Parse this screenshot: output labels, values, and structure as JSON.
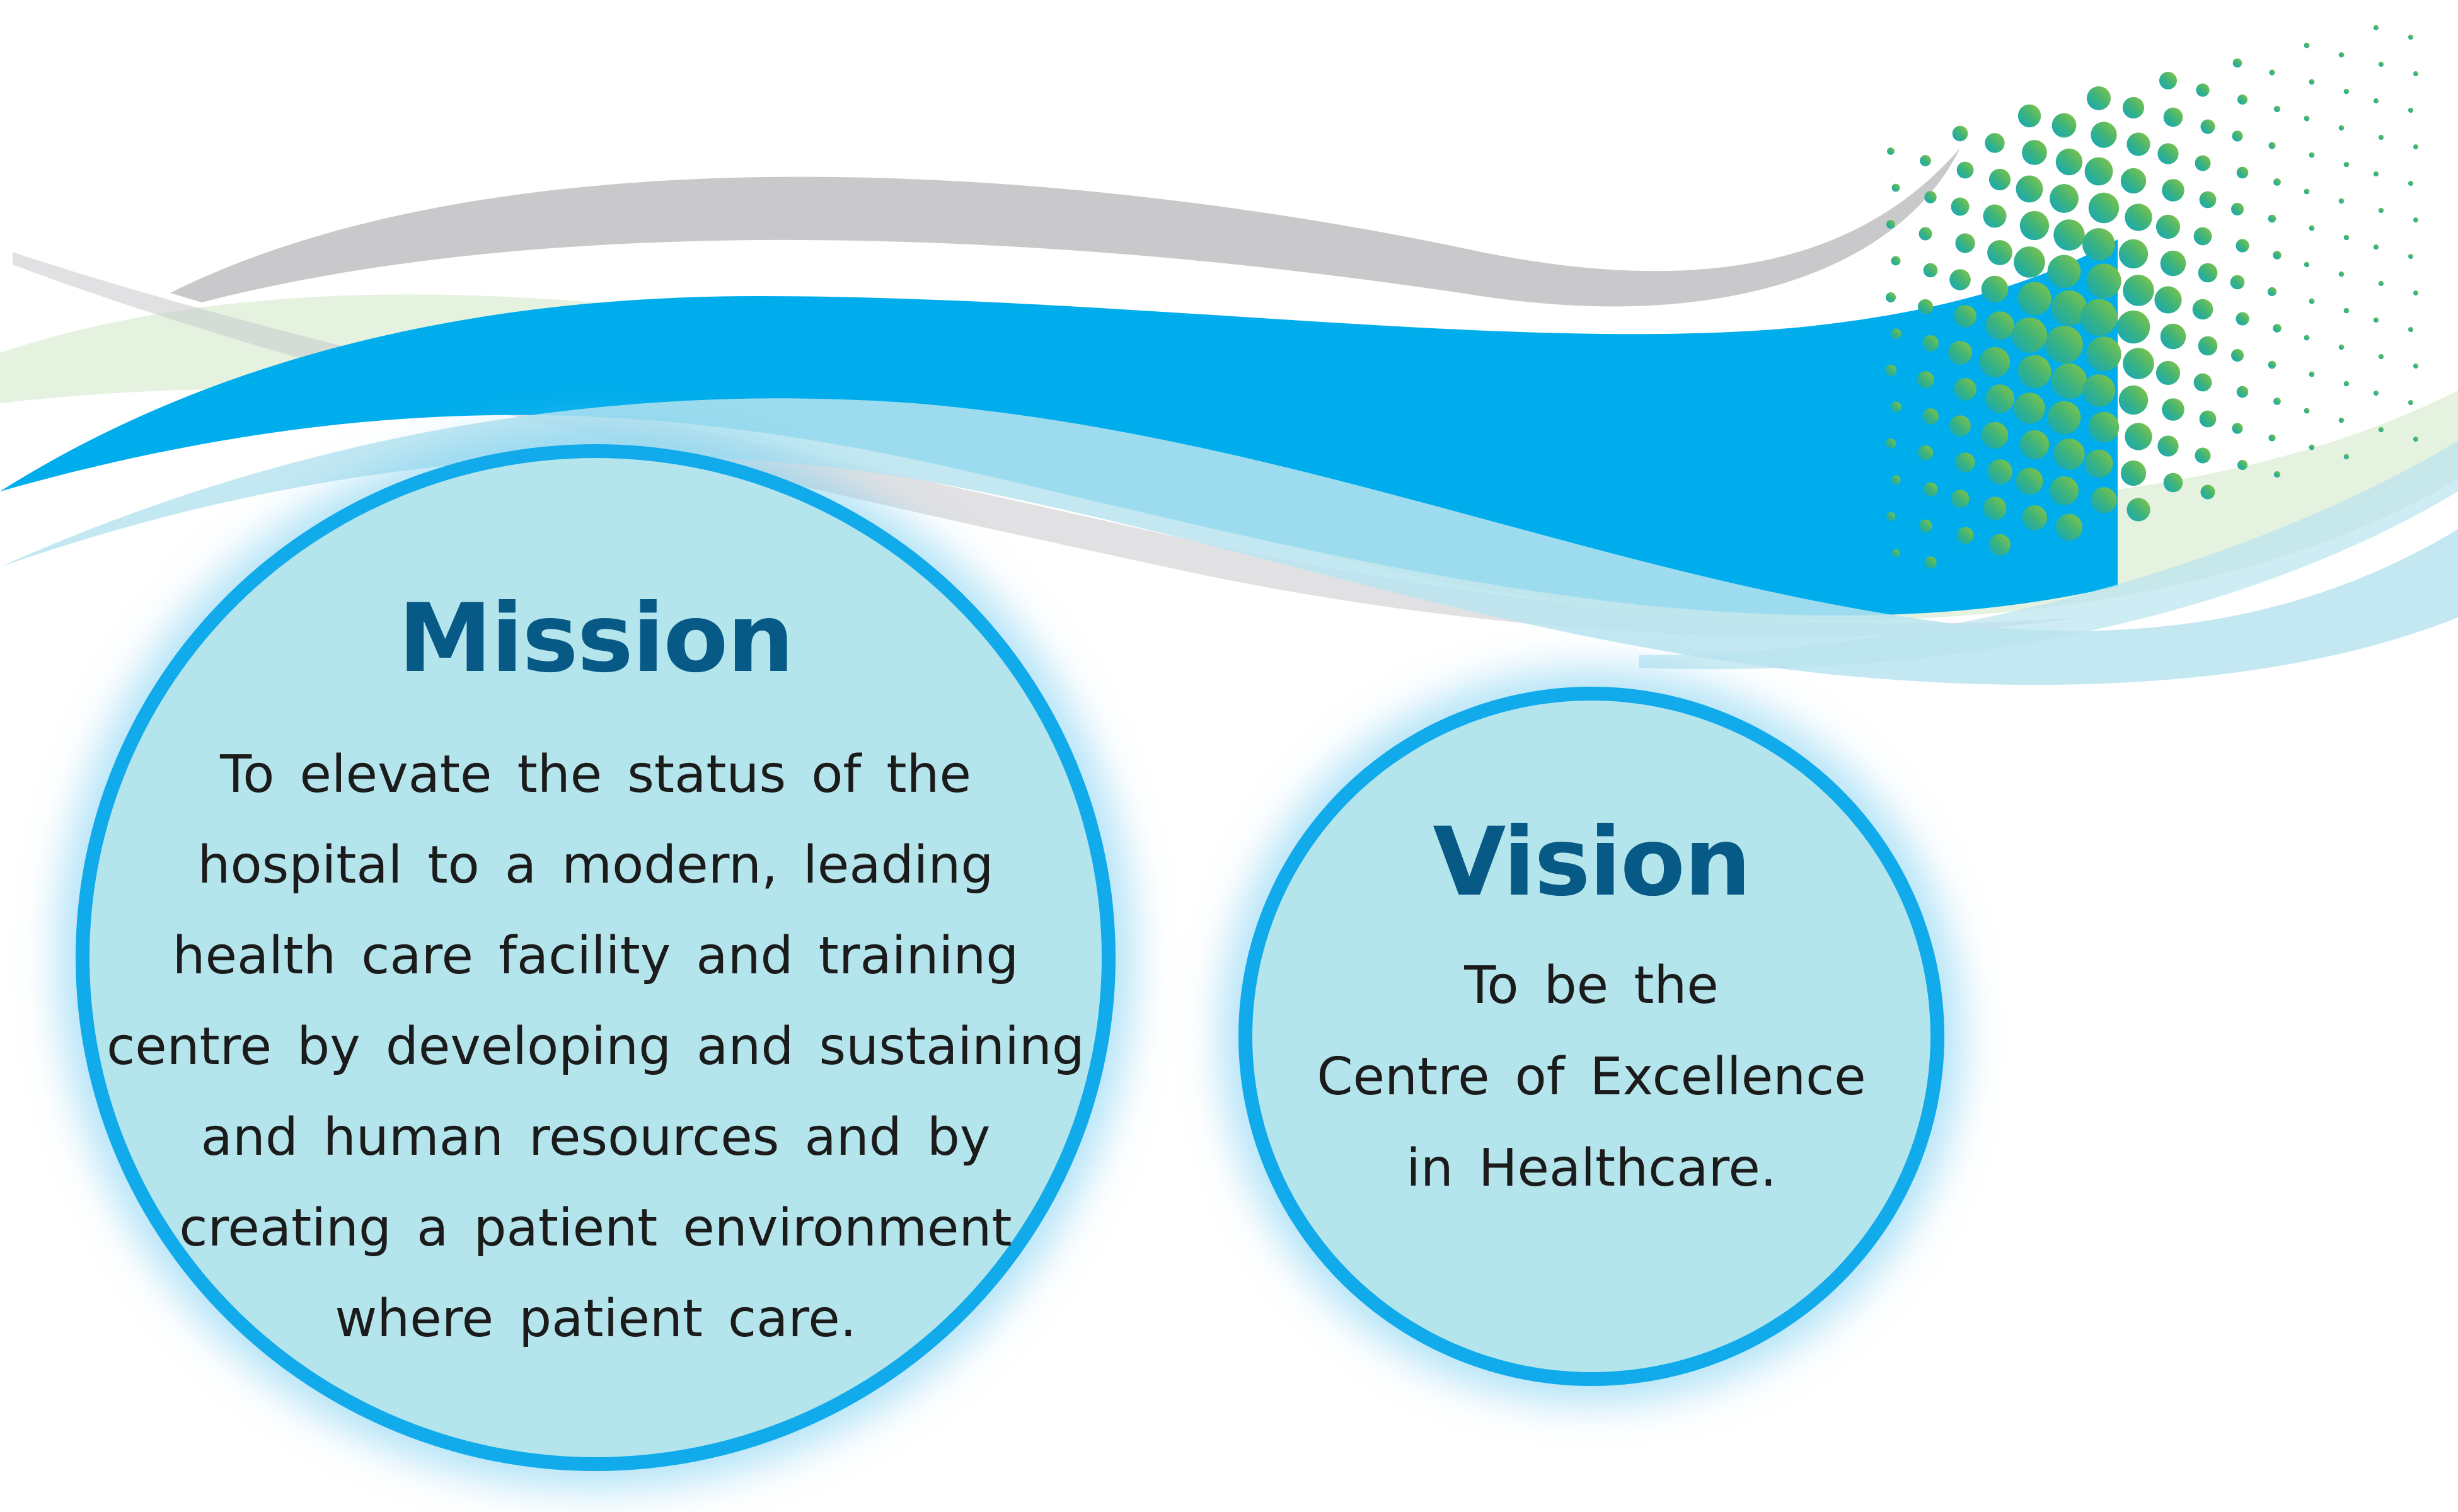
{
  "colors": {
    "wave_main": "#00adec",
    "wave_light": "#b9e4f0",
    "wave_gray": "#cbcbcd",
    "dots_green": "#6cc04a",
    "dots_teal": "#1bae9f",
    "circle_fill": "#b5e5ec",
    "circle_border": "#11aaeb",
    "heading": "#075a86",
    "body_text": "#1b1b1b"
  },
  "mission": {
    "title": "Mission",
    "lines": [
      "To elevate the status of the",
      "hospital to a modern, leading",
      "health care facility and training",
      "centre by developing and sustaining",
      "and human resources and by",
      "creating a patient environment",
      "where patient care."
    ]
  },
  "vision": {
    "title": "Vision",
    "lines": [
      "To be the",
      "Centre of Excellence",
      "in Healthcare."
    ]
  }
}
